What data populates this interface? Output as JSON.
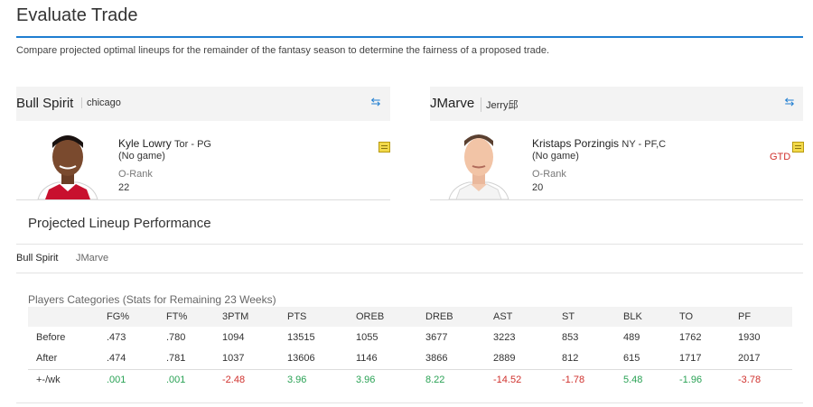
{
  "page": {
    "title": "Evaluate Trade",
    "subtitle": "Compare projected optimal lineups for the remainder of the fantasy season to determine the fairness of a proposed trade."
  },
  "teams": [
    {
      "name": "Bull Spirit",
      "owner": "chicago",
      "player": {
        "name": "Kyle Lowry",
        "team_pos": "Tor - PG",
        "status": "(No game)",
        "orank_label": "O-Rank",
        "orank": "22",
        "injury": ""
      }
    },
    {
      "name": "JMarve",
      "owner": "Jerry邱",
      "player": {
        "name": "Kristaps Porzingis",
        "team_pos": "NY - PF,C",
        "status": "(No game)",
        "orank_label": "O-Rank",
        "orank": "20",
        "injury": "GTD"
      }
    }
  ],
  "performance": {
    "title": "Projected Lineup Performance",
    "tabs": [
      "Bull Spirit",
      "JMarve"
    ],
    "categories_title": "Players Categories (Stats for Remaining 23 Weeks)",
    "columns": [
      "FG%",
      "FT%",
      "3PTM",
      "PTS",
      "OREB",
      "DREB",
      "AST",
      "ST",
      "BLK",
      "TO",
      "PF"
    ],
    "rows": [
      {
        "label": "Before",
        "values": [
          ".473",
          ".780",
          "1094",
          "13515",
          "1055",
          "3677",
          "3223",
          "853",
          "489",
          "1762",
          "1930"
        ]
      },
      {
        "label": "After",
        "values": [
          ".474",
          ".781",
          "1037",
          "13606",
          "1146",
          "3866",
          "2889",
          "812",
          "615",
          "1717",
          "2017"
        ]
      },
      {
        "label": "+-/wk",
        "values": [
          ".001",
          ".001",
          "-2.48",
          "3.96",
          "3.96",
          "8.22",
          "-14.52",
          "-1.78",
          "5.48",
          "-1.96",
          "-3.78"
        ],
        "signs": [
          "pos",
          "pos",
          "neg",
          "pos",
          "pos",
          "pos",
          "neg",
          "neg",
          "pos",
          "pos",
          "neg"
        ]
      }
    ]
  },
  "colors": {
    "accent": "#1f7ed1",
    "positive": "#2aa255",
    "negative": "#d0312d",
    "header_bg": "#f3f3f3"
  },
  "icons": {
    "swap": "swap-arrows-icon",
    "note": "note-icon"
  }
}
